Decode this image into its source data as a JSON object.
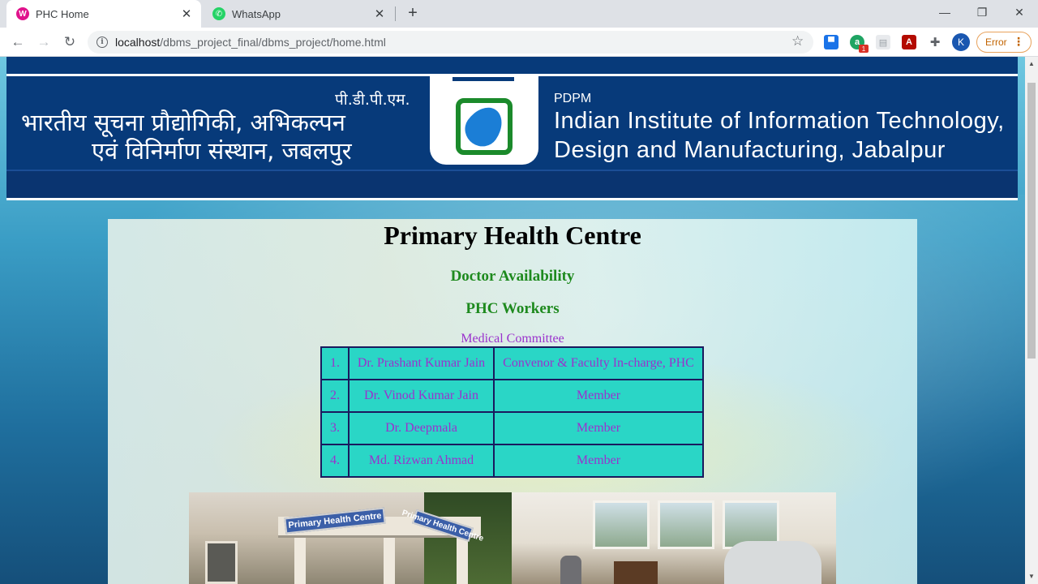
{
  "browser": {
    "tabs": [
      {
        "title": "PHC Home",
        "favicon": "phc-favicon",
        "active": true
      },
      {
        "title": "WhatsApp",
        "favicon": "whatsapp-favicon",
        "active": false
      }
    ],
    "url_host": "localhost",
    "url_path": "/dbms_project_final/dbms_project/home.html",
    "profile_initial": "K",
    "status_label": "Error",
    "extension_badge": "1"
  },
  "banner": {
    "hindi_abbr": "पी.डी.पी.एम.",
    "hindi_line1": "भारतीय सूचना प्रौद्योगिकी, अभिकल्पन",
    "hindi_line2": "एवं विनिर्माण संस्थान, जबलपुर",
    "english_abbr": "PDPM",
    "english_line1": "Indian Institute of Information Technology,",
    "english_line2": "Design and Manufacturing, Jabalpur"
  },
  "main": {
    "title": "Primary Health Centre",
    "links": [
      {
        "label": "Doctor Availability"
      },
      {
        "label": "PHC Workers"
      }
    ],
    "committee_caption": "Medical Committee",
    "committee": [
      {
        "no": "1.",
        "name": "Dr. Prashant Kumar Jain",
        "role": "Convenor & Faculty In-charge, PHC"
      },
      {
        "no": "2.",
        "name": "Dr. Vinod Kumar Jain",
        "role": "Member"
      },
      {
        "no": "3.",
        "name": "Dr. Deepmala",
        "role": "Member"
      },
      {
        "no": "4.",
        "name": "Md. Rizwan Ahmad",
        "role": "Member"
      }
    ],
    "photo_sign_main": "Primary Health Centre",
    "photo_sign_side": "Primary Health Centre"
  },
  "colors": {
    "banner_blue": "#073a7a",
    "heading_green": "#1e8a1e",
    "committee_text": "#9a32cd",
    "table_cell": "#2ad6c6"
  }
}
